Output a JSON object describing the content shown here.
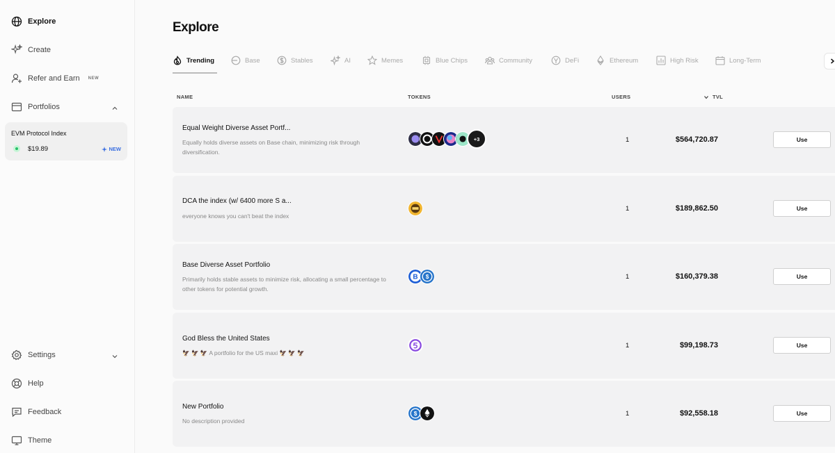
{
  "sidebar": {
    "nav": [
      {
        "label": "Explore",
        "icon": "globe-icon"
      },
      {
        "label": "Create",
        "icon": "sparkle-icon"
      },
      {
        "label": "Refer and Earn",
        "icon": "person-add-icon",
        "badge": "NEW"
      },
      {
        "label": "Portfolios",
        "icon": "wallet-icon"
      }
    ],
    "portfolio_card": {
      "name": "EVM Protocol Index",
      "value": "$19.89",
      "badge": "NEW"
    },
    "bottom": [
      {
        "label": "Settings",
        "icon": "gear-icon"
      },
      {
        "label": "Help",
        "icon": "lifebuoy-icon"
      },
      {
        "label": "Feedback",
        "icon": "message-icon"
      },
      {
        "label": "Theme",
        "icon": "monitor-icon"
      }
    ]
  },
  "main": {
    "title": "Explore",
    "tabs": [
      {
        "label": "Trending",
        "icon": "flame-icon"
      },
      {
        "label": "Base",
        "icon": "base-icon"
      },
      {
        "label": "Stables",
        "icon": "dollar-icon"
      },
      {
        "label": "AI",
        "icon": "sparkle-icon"
      },
      {
        "label": "Memes",
        "icon": "star-icon"
      },
      {
        "label": "Blue Chips",
        "icon": "chip-icon"
      },
      {
        "label": "Community",
        "icon": "users-icon"
      },
      {
        "label": "DeFi",
        "icon": "defi-icon"
      },
      {
        "label": "Ethereum",
        "icon": "ethereum-icon"
      },
      {
        "label": "High Risk",
        "icon": "chart-bars-icon"
      },
      {
        "label": "Long-Term",
        "icon": "calendar-icon"
      }
    ],
    "columns": {
      "name": "NAME",
      "tokens": "TOKENS",
      "users": "USERS",
      "tvl": "TVL"
    },
    "rows": [
      {
        "title": "Equal Weight Diverse Asset Portf...",
        "desc": "Equally holds diverse assets on Base chain, minimizing risk through diversification.",
        "users": "1",
        "tvl": "$564,720.87",
        "action": "Use",
        "more": "+3"
      },
      {
        "title": "DCA the index (w/ 6400 more S a...",
        "desc": "everyone knows you can't beat the index",
        "users": "1",
        "tvl": "$189,862.50",
        "action": "Use"
      },
      {
        "title": "Base Diverse Asset Portfolio",
        "desc": "Primarily holds stable assets to minimize risk, allocating a small percentage to other tokens for potential growth.",
        "users": "1",
        "tvl": "$160,379.38",
        "action": "Use"
      },
      {
        "title": "God Bless the United States",
        "desc": "🦅 🦅 🦅 A portfolio for the US maxi 🦅 🦅 🦅",
        "users": "1",
        "tvl": "$99,198.73",
        "action": "Use"
      },
      {
        "title": "New Portfolio",
        "desc": "No description provided",
        "users": "1",
        "tvl": "$92,558.18",
        "action": "Use"
      }
    ]
  },
  "colors": {
    "accent": "#3b6fe0",
    "row_bg": "#f2f2f3",
    "active_dot": "#26c06a"
  }
}
